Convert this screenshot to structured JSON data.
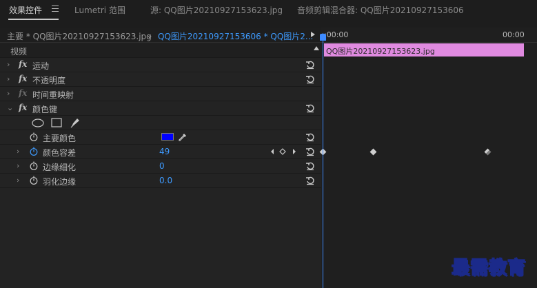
{
  "tabs": [
    {
      "label": "效果控件",
      "active": true
    },
    {
      "label": "Lumetri 范围",
      "active": false
    },
    {
      "label": "源: QQ图片20210927153623.jpg",
      "active": false
    },
    {
      "label": "音频剪辑混合器: QQ图片20210927153606",
      "active": false
    }
  ],
  "sequence": {
    "source_label": "主要 * QQ图片20210927153623.jpg",
    "target_label": "QQ图片20210927153606 * QQ图片2..."
  },
  "section": {
    "label": "视频"
  },
  "effects": [
    {
      "label": "运动"
    },
    {
      "label": "不透明度"
    },
    {
      "label": "时间重映射"
    },
    {
      "label": "颜色键"
    }
  ],
  "color_key": {
    "main_color_label": "主要颜色",
    "main_color": "#0000ff",
    "tolerance_label": "颜色容差",
    "tolerance_value": "49",
    "edge_thin_label": "边缘细化",
    "edge_thin_value": "0",
    "feather_label": "羽化边缘",
    "feather_value": "0.0"
  },
  "timeline": {
    "start_time": ":00:00",
    "end_time": "00:00",
    "clip_label": "QQ图片20210927153623.jpg",
    "clip_color": "#e08ae0"
  },
  "watermark": "最需教育",
  "colors": {
    "accent": "#3e9bff",
    "playhead": "#3e8bff"
  }
}
